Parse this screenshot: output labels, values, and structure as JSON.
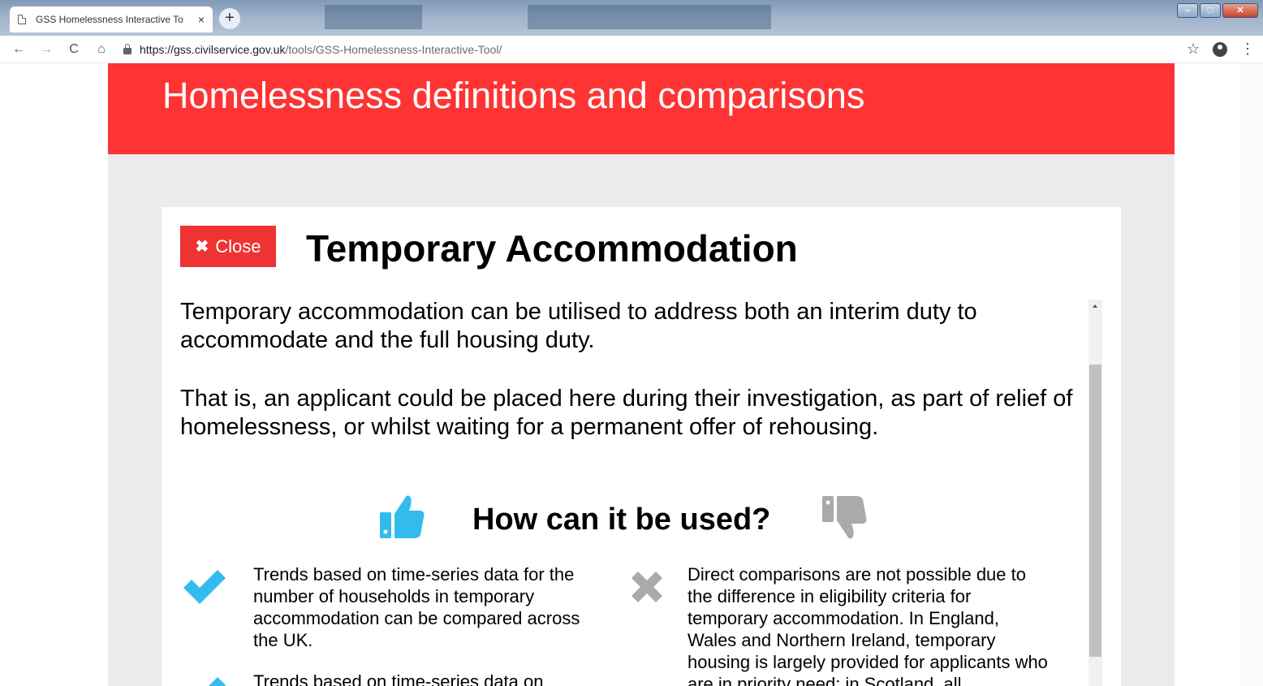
{
  "browser": {
    "tab_title": "GSS Homelessness Interactive To",
    "tab_close": "×",
    "new_tab": "+",
    "url_domain": "https://gss.civilservice.gov.uk",
    "url_path": "/tools/GSS-Homelessness-Interactive-Tool/",
    "nav": {
      "back": "←",
      "forward": "→",
      "reload": "C",
      "home": "⌂"
    },
    "bookmark": "☆",
    "menu": "⋮",
    "window_buttons": {
      "minimize": "–",
      "maximize": "□",
      "close": "✕"
    }
  },
  "page": {
    "hero_title": "Homelessness definitions and comparisons",
    "modal": {
      "close_label": "Close",
      "close_symbol": "✖",
      "title": "Temporary Accommodation",
      "paragraphs": [
        "Temporary accommodation can be utilised to address both an interim duty to accommodate and the full housing duty.",
        "That is, an applicant could be placed here during their investigation, as part of relief of homelessness, or whilst waiting for a permanent offer of rehousing."
      ],
      "usage_title": "How can it be used?",
      "pros": [
        "Trends based on time-series data for the number of households in temporary accommodation can be compared across the UK.",
        "Trends based on time-series data on"
      ],
      "cons": [
        "Direct comparisons are not possible due to the difference in eligibility criteria for temporary accommodation. In England, Wales and Northern Ireland, temporary housing is largely provided for applicants who are in priority need; in Scotland, all"
      ]
    }
  },
  "colors": {
    "hero": "#ff3333",
    "close_button": "#ee3333",
    "thumb_up": "#33bbee",
    "thumb_down": "#aaaaaa",
    "check": "#33bbee",
    "cross": "#aaaaaa"
  }
}
